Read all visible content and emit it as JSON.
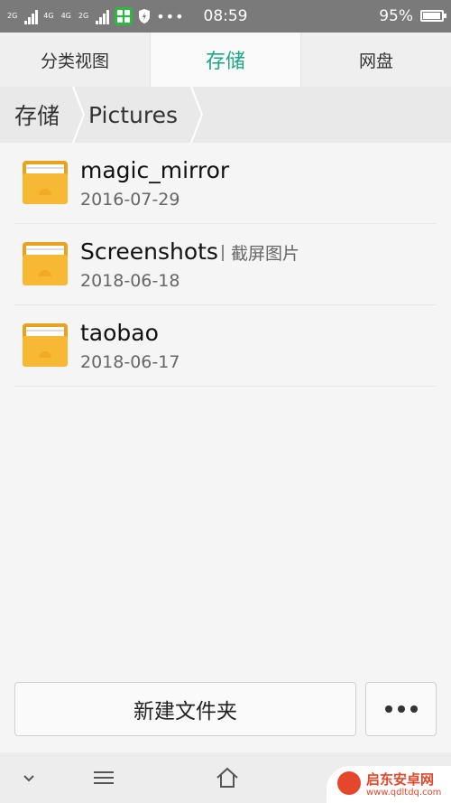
{
  "status_bar": {
    "net1": "2G",
    "net2": "4G",
    "net3": "4G",
    "net4": "2G",
    "time": "08:59",
    "battery": "95%",
    "battery_level": 0.95
  },
  "tabs": [
    {
      "label": "分类视图"
    },
    {
      "label": "存储"
    },
    {
      "label": "网盘"
    }
  ],
  "breadcrumb": [
    {
      "label": "存储"
    },
    {
      "label": "Pictures"
    }
  ],
  "files": [
    {
      "name": "magic_mirror",
      "tag": "",
      "date": "2016-07-29"
    },
    {
      "name": "Screenshots",
      "tag": "截屏图片",
      "date": "2018-06-18"
    },
    {
      "name": "taobao",
      "tag": "",
      "date": "2018-06-17"
    }
  ],
  "actions": {
    "new_folder": "新建文件夹"
  },
  "watermark": {
    "title": "启东安卓网",
    "url": "www.qdltdq.com"
  },
  "colors": {
    "accent": "#1ba784",
    "folder": "#f5b323",
    "status_bar": "#7a7a7a"
  },
  "icons": [
    "signal-icon",
    "app-icon",
    "shield-icon",
    "more-icon",
    "battery-icon",
    "folder-icon",
    "chevron-down-icon",
    "menu-icon",
    "home-icon"
  ]
}
